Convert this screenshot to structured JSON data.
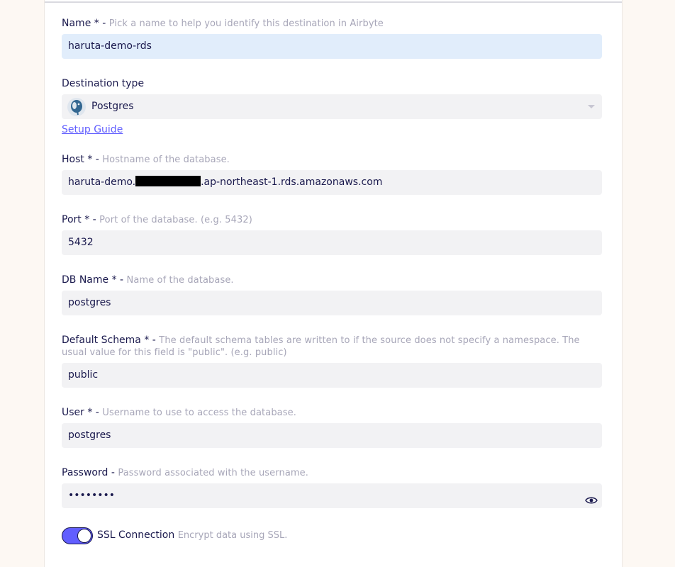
{
  "form": {
    "name": {
      "title": "Name * -",
      "desc": "Pick a name to help you identify this destination in Airbyte",
      "value": "haruta-demo-rds"
    },
    "destination_type": {
      "title": "Destination type",
      "value": "Postgres",
      "icon": "postgres-elephant-icon"
    },
    "setup_guide": "Setup Guide",
    "host": {
      "title": "Host * -",
      "desc": "Hostname of the database.",
      "value_prefix": "haruta-demo.",
      "value_suffix": ".ap-northeast-1.rds.amazonaws.com"
    },
    "port": {
      "title": "Port * -",
      "desc": "Port of the database. (e.g. 5432)",
      "value": "5432"
    },
    "db_name": {
      "title": "DB Name * -",
      "desc": "Name of the database.",
      "value": "postgres"
    },
    "schema": {
      "title": "Default Schema * -",
      "desc": "The default schema tables are written to if the source does not specify a namespace. The usual value for this field is \"public\". (e.g. public)",
      "value": "public"
    },
    "user": {
      "title": "User * -",
      "desc": "Username to use to access the database.",
      "value": "postgres"
    },
    "password": {
      "title": "Password -",
      "desc": "Password associated with the username.",
      "value": "••••••••"
    },
    "ssl": {
      "title": "SSL Connection",
      "desc": "Encrypt data using SSL.",
      "enabled": true
    }
  },
  "colors": {
    "accent": "#615eff",
    "text": "#1a194d",
    "muted": "#a7a6b8",
    "input_bg": "#f2f2f4",
    "focus_bg": "#e1edfb"
  }
}
